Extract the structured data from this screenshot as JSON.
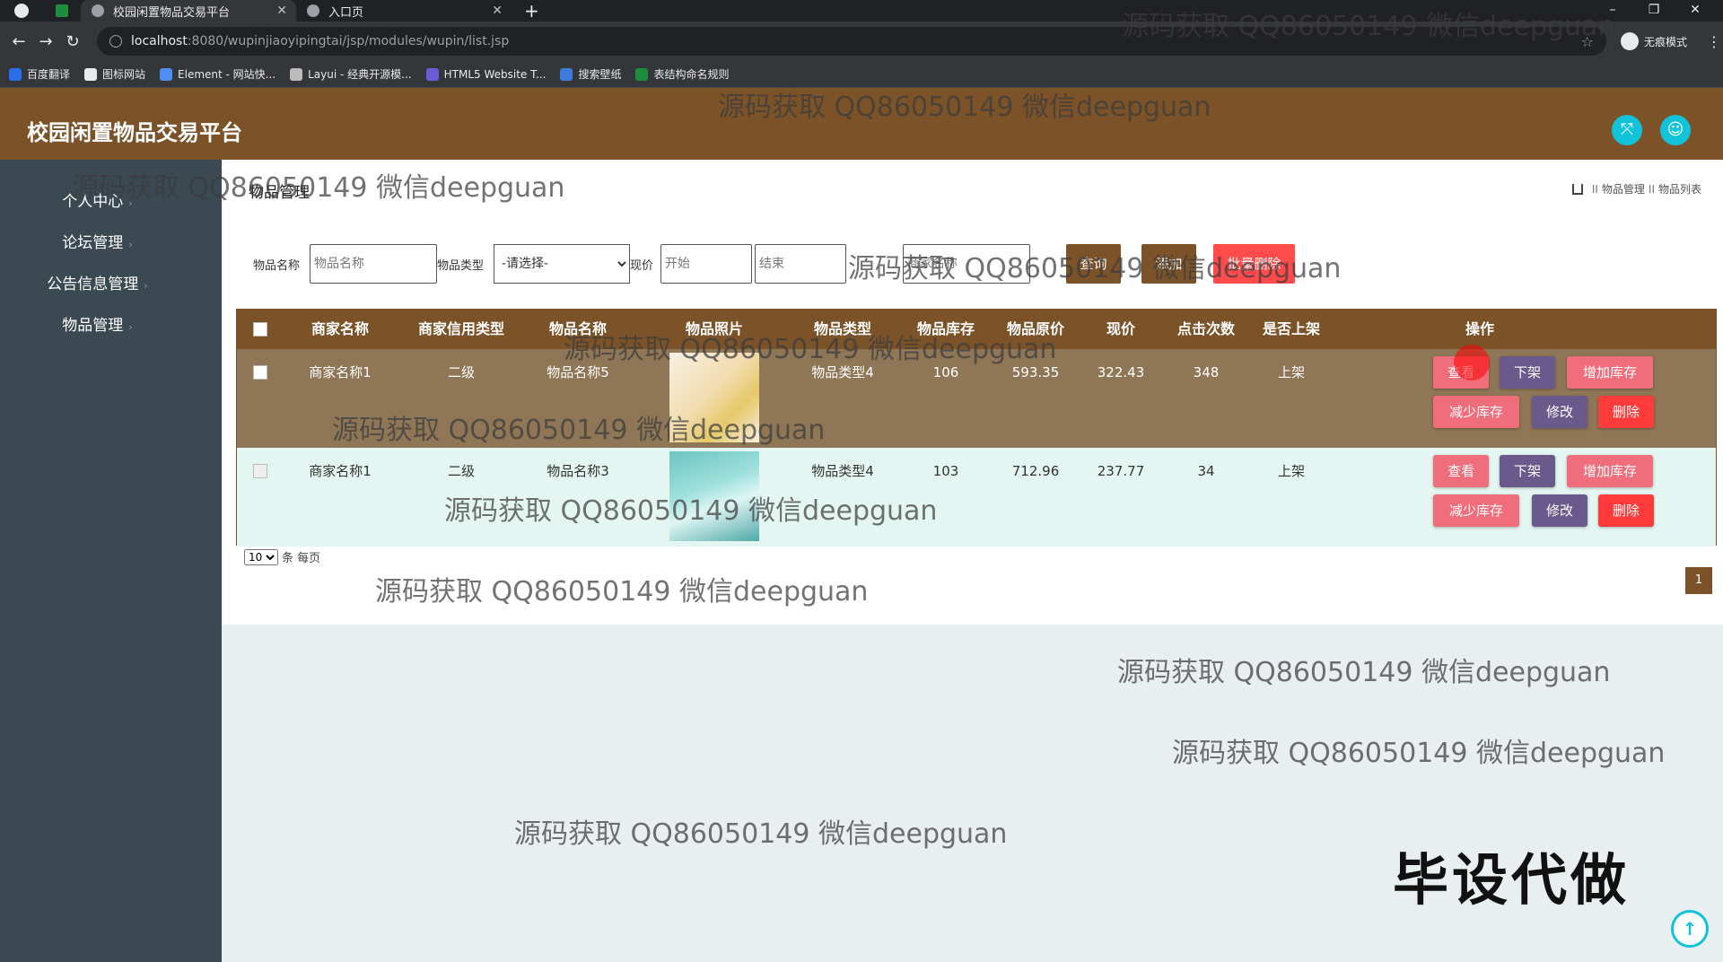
{
  "browser": {
    "tabs": [
      {
        "title": "校园闲置物品交易平台",
        "active": true
      },
      {
        "title": "入口页",
        "active": false
      }
    ],
    "new_tab": "+",
    "window_controls": [
      "–",
      "❐",
      "✕"
    ],
    "url_host": "localhost",
    "url_path": ":8080/wupinjiaoyipingtai/jsp/modules/wupin/list.jsp",
    "incognito_label": "无痕模式",
    "bookmarks": [
      {
        "label": "百度翻译",
        "color": "#2b6fe8"
      },
      {
        "label": "图标网站",
        "color": "#e8eaed"
      },
      {
        "label": "Element - 网站快...",
        "color": "#4f8ef7"
      },
      {
        "label": "Layui - 经典开源模...",
        "color": "#bbbbbb"
      },
      {
        "label": "HTML5 Website T...",
        "color": "#6b5bd6"
      },
      {
        "label": "搜索壁纸",
        "color": "#3d7bd9"
      },
      {
        "label": "表结构命名规则",
        "color": "#1e8e3e"
      }
    ]
  },
  "header": {
    "title": "校园闲置物品交易平台",
    "accent_color": "#11c3d8",
    "brand_color": "#7c5328"
  },
  "sidebar": {
    "items": [
      {
        "label": "个人中心"
      },
      {
        "label": "论坛管理"
      },
      {
        "label": "公告信息管理"
      },
      {
        "label": "物品管理"
      }
    ]
  },
  "page": {
    "heading": "物品管理",
    "breadcrumb": [
      "物品管理",
      "物品列表"
    ],
    "breadcrumb_sep": "II"
  },
  "search": {
    "name_label": "物品名称",
    "name_placeholder": "物品名称",
    "type_label": "物品类型",
    "type_selected": "-请选择-",
    "price_label": "现价",
    "price_start_placeholder": "开始",
    "price_end_placeholder": "结束",
    "merchant_placeholder": "商家名称",
    "query_btn": "查询",
    "add_btn": "添加",
    "batch_delete_btn": "批量删除"
  },
  "table": {
    "columns": [
      "商家名称",
      "商家信用类型",
      "物品名称",
      "物品照片",
      "物品类型",
      "物品库存",
      "物品原价",
      "现价",
      "点击次数",
      "是否上架",
      "操作"
    ],
    "rows": [
      {
        "merchant": "商家名称1",
        "credit": "二级",
        "name": "物品名称5",
        "photo": "product-photo-skincare-box",
        "type": "物品类型4",
        "stock": "106",
        "orig_price": "593.35",
        "price": "322.43",
        "clicks": "348",
        "on_shelf": "上架"
      },
      {
        "merchant": "商家名称1",
        "credit": "二级",
        "name": "物品名称3",
        "photo": "product-photo-skincare-bottles",
        "type": "物品类型4",
        "stock": "103",
        "orig_price": "712.96",
        "price": "237.77",
        "clicks": "34",
        "on_shelf": "上架"
      }
    ],
    "actions": {
      "view": "查看",
      "unlist": "下架",
      "add_stock": "增加库存",
      "sub_stock": "减少库存",
      "edit": "修改",
      "delete": "删除"
    }
  },
  "pagination": {
    "page_size": "10",
    "per_page_label": "条 每页",
    "current_page": "1"
  },
  "overlay": {
    "watermark": "源码获取 QQ86050149 微信deepguan",
    "promo": "毕设代做"
  }
}
